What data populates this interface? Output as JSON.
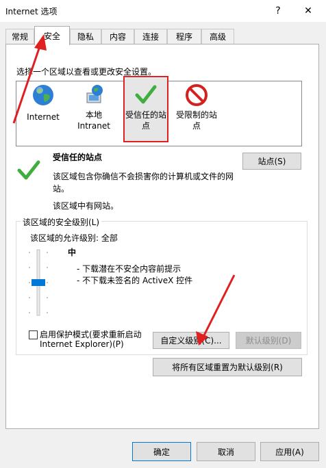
{
  "window": {
    "title": "Internet 选项",
    "help": "?",
    "close": "✕"
  },
  "tabs": [
    "常规",
    "安全",
    "隐私",
    "内容",
    "连接",
    "程序",
    "高级"
  ],
  "instruction": "选择一个区域以查看或更改安全设置。",
  "zones": [
    {
      "label_l1": "Internet",
      "label_l2": ""
    },
    {
      "label_l1": "本地",
      "label_l2": "Intranet"
    },
    {
      "label_l1": "受信任的站",
      "label_l2": "点"
    },
    {
      "label_l1": "受限制的站",
      "label_l2": "点"
    }
  ],
  "selected_zone": {
    "title": "受信任的站点",
    "desc_l1": "该区域包含你确信不会损害你的计算机或文件的网",
    "desc_l2": "站。",
    "note": "该区域中有网站。",
    "sites_button": "站点(S)"
  },
  "security_level": {
    "group_label": "该区域的安全级别(L)",
    "allowed": "该区域的允许级别: 全部",
    "level": "中",
    "bullet1": "- 下载潜在不安全内容前提示",
    "bullet2": "- 不下载未签名的 ActiveX 控件",
    "slider_value_fraction": 0.5
  },
  "protected_mode": {
    "label_l1": "启用保护模式(要求重新启动",
    "label_l2": "Internet Explorer)(P)",
    "checked": false
  },
  "buttons": {
    "custom": "自定义级别(C)...",
    "default": "默认级别(D)",
    "reset_all": "将所有区域重置为默认级别(R)",
    "ok": "确定",
    "cancel": "取消",
    "apply": "应用(A)"
  },
  "colors": {
    "annotation_red": "#e02020",
    "accent": "#0078d7",
    "check_green": "#3fae3f",
    "stop_red": "#d42020"
  }
}
